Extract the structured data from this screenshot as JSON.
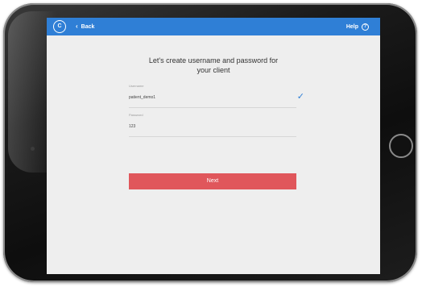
{
  "header": {
    "logo_text": "C",
    "back_label": "Back",
    "help_label": "Help",
    "help_icon": "?"
  },
  "main": {
    "heading_line1": "Let's create username and password for",
    "heading_line2": "your client",
    "username": {
      "label": "Username",
      "value": "patient_demo1",
      "valid": true
    },
    "password": {
      "label": "Password",
      "value": "123"
    },
    "next_label": "Next"
  },
  "colors": {
    "topbar": "#2f7fd6",
    "primary_button": "#e0565b",
    "check": "#2f7fd6"
  },
  "icons": {
    "logo": "logo-icon",
    "back": "chevron-left-icon",
    "help": "help-circle-icon",
    "valid": "checkmark-icon"
  }
}
